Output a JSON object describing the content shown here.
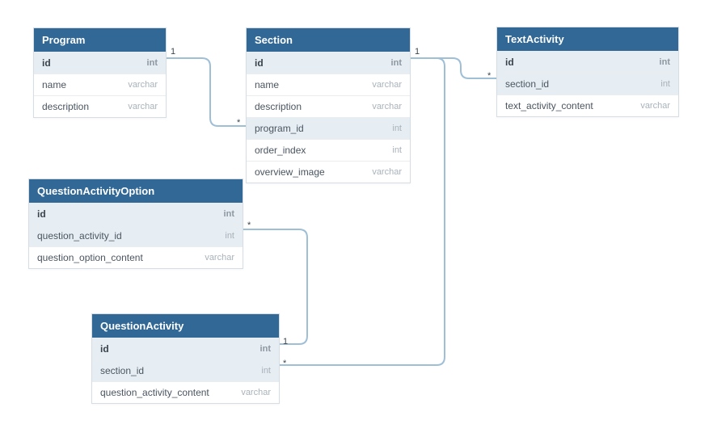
{
  "entities": {
    "program": {
      "title": "Program",
      "fields": [
        {
          "name": "id",
          "type": "int"
        },
        {
          "name": "name",
          "type": "varchar"
        },
        {
          "name": "description",
          "type": "varchar"
        }
      ]
    },
    "section": {
      "title": "Section",
      "fields": [
        {
          "name": "id",
          "type": "int"
        },
        {
          "name": "name",
          "type": "varchar"
        },
        {
          "name": "description",
          "type": "varchar"
        },
        {
          "name": "program_id",
          "type": "int"
        },
        {
          "name": "order_index",
          "type": "int"
        },
        {
          "name": "overview_image",
          "type": "varchar"
        }
      ]
    },
    "textActivity": {
      "title": "TextActivity",
      "fields": [
        {
          "name": "id",
          "type": "int"
        },
        {
          "name": "section_id",
          "type": "int"
        },
        {
          "name": "text_activity_content",
          "type": "varchar"
        }
      ]
    },
    "questionActivityOption": {
      "title": "QuestionActivityOption",
      "fields": [
        {
          "name": "id",
          "type": "int"
        },
        {
          "name": "question_activity_id",
          "type": "int"
        },
        {
          "name": "question_option_content",
          "type": "varchar"
        }
      ]
    },
    "questionActivity": {
      "title": "QuestionActivity",
      "fields": [
        {
          "name": "id",
          "type": "int"
        },
        {
          "name": "section_id",
          "type": "int"
        },
        {
          "name": "question_activity_content",
          "type": "varchar"
        }
      ]
    }
  },
  "relationships": [
    {
      "from": "Program.id",
      "to": "Section.program_id",
      "from_card": "1",
      "to_card": "*"
    },
    {
      "from": "Section.id",
      "to": "TextActivity.section_id",
      "from_card": "1",
      "to_card": "*"
    },
    {
      "from": "Section.id",
      "to": "QuestionActivity.section_id",
      "from_card": "1",
      "to_card": "*"
    },
    {
      "from": "QuestionActivity.id",
      "to": "QuestionActivityOption.question_activity_id",
      "from_card": "1",
      "to_card": "*"
    }
  ],
  "cardinalities": {
    "c1": "1",
    "c2": "*",
    "c3": "1",
    "c4": "*",
    "c5": "*",
    "c6": "1",
    "c7": "*"
  }
}
